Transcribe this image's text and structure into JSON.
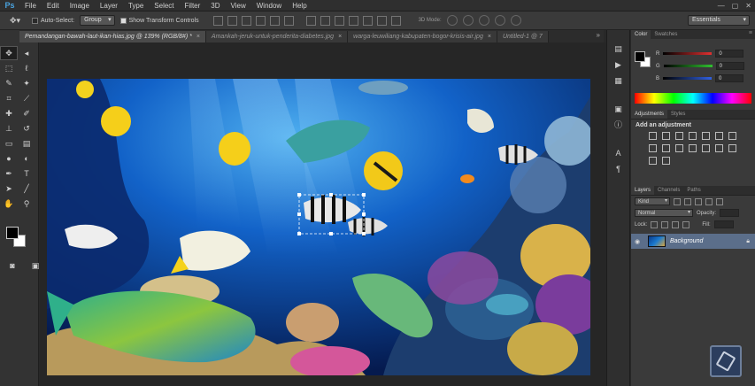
{
  "app": {
    "logo": "Ps",
    "menu": [
      "File",
      "Edit",
      "Image",
      "Layer",
      "Type",
      "Select",
      "Filter",
      "3D",
      "View",
      "Window",
      "Help"
    ]
  },
  "options": {
    "auto_select_label": "Auto-Select:",
    "auto_select_value": "Group",
    "transform_label": "Show Transform Controls",
    "mode_3d_label": "3D Mode:",
    "workspace": "Essentials"
  },
  "tabs": [
    {
      "label": "Pemandangan-bawah-laut-ikan-hias.jpg @ 139% (RGB/8#) *",
      "active": true
    },
    {
      "label": "Amankah-jeruk-untuk-penderita-diabetes.jpg",
      "active": false
    },
    {
      "label": "warga-leuwiliang-kabupaten-bogor-krisis-air.jpg",
      "active": false
    },
    {
      "label": "Untitled-1 @ 7",
      "active": false
    }
  ],
  "tools": [
    [
      "move-tool",
      "artboard-tool"
    ],
    [
      "marquee-tool",
      "lasso-tool"
    ],
    [
      "quick-select-tool",
      "magic-wand-tool"
    ],
    [
      "crop-tool",
      "eyedropper-tool"
    ],
    [
      "healing-brush-tool",
      "brush-tool"
    ],
    [
      "clone-stamp-tool",
      "history-brush-tool"
    ],
    [
      "eraser-tool",
      "gradient-tool"
    ],
    [
      "blur-tool",
      "dodge-tool"
    ],
    [
      "pen-tool",
      "type-tool"
    ],
    [
      "path-select-tool",
      "line-tool"
    ],
    [
      "hand-tool",
      "zoom-tool"
    ]
  ],
  "color_panel": {
    "tabs": [
      "Color",
      "Swatches"
    ],
    "channels": [
      {
        "name": "R",
        "value": "0",
        "color": "#e03030"
      },
      {
        "name": "G",
        "value": "0",
        "color": "#30c030"
      },
      {
        "name": "B",
        "value": "0",
        "color": "#3060e0"
      }
    ]
  },
  "adjustments_panel": {
    "tabs": [
      "Adjustments",
      "Styles"
    ],
    "title": "Add an adjustment"
  },
  "layers_panel": {
    "tabs": [
      "Layers",
      "Channels",
      "Paths"
    ],
    "kind_label": "Kind",
    "blend_mode": "Normal",
    "opacity_label": "Opacity:",
    "lock_label": "Lock:",
    "fill_label": "Fill:",
    "layers": [
      {
        "name": "Background",
        "visible": true,
        "locked": true
      }
    ]
  },
  "colors": {
    "ui_dark": "#282828",
    "panel": "#3a3a3a",
    "layer_selected": "#5b6e8a",
    "ps_blue": "#4aa3df"
  }
}
